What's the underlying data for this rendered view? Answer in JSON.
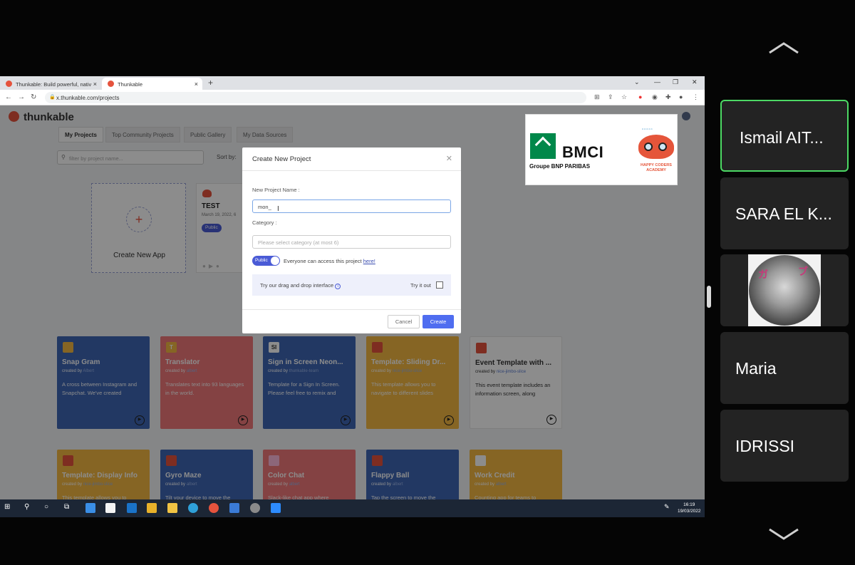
{
  "browser": {
    "tabs": [
      {
        "title": "Thunkable: Build powerful, nativ"
      },
      {
        "title": "Thunkable"
      }
    ],
    "url": "x.thunkable.com/projects"
  },
  "app": {
    "brand": "thunkable",
    "nav_tabs": [
      "My Projects",
      "Top Community Projects",
      "Public Gallery",
      "My Data Sources"
    ],
    "filter_placeholder": "filter by project name...",
    "sort_label": "Sort by:",
    "create_new_app": "Create New App",
    "project": {
      "name": "TEST",
      "date": "March 19, 2022, 6",
      "badge": "Public"
    }
  },
  "templates": [
    {
      "icon": "",
      "title": "Snap Gram",
      "by": "created by",
      "author": "Albert",
      "desc": "A cross between Instagram and Snapchat. We've created",
      "color": "#3e66b4"
    },
    {
      "icon": "T",
      "title": "Translator",
      "by": "created by",
      "author": "albert",
      "desc": "Translates text into 93 languages in the world.",
      "color": "#f0787a"
    },
    {
      "icon": "SI",
      "title": "Sign in Screen Neon...",
      "by": "created by",
      "author": "thunkable-team",
      "desc": "Template for a Sign In Screen. Please feel free to remix and",
      "color": "#3e66b4"
    },
    {
      "icon": "",
      "title": "Template: Sliding Dr...",
      "by": "created by",
      "author": "nice-jimbo-slice",
      "desc": "This template allows you to navigate to different slides",
      "color": "#f4b942"
    },
    {
      "icon": "",
      "title": "Event Template with ...",
      "by": "created by",
      "author": "nice-jimbo-slice",
      "desc": "This event template includes an information screen, along",
      "color": "#ffffff"
    },
    {
      "icon": "",
      "title": "Template: Display Info",
      "by": "created by",
      "author": "nice-jimbo-slice",
      "desc": "This template allows you to",
      "color": "#f4b942"
    },
    {
      "icon": "",
      "title": "Gyro Maze",
      "by": "created by",
      "author": "albert",
      "desc": "Tilt your device to move the",
      "color": "#3e66b4"
    },
    {
      "icon": "",
      "title": "Color Chat",
      "by": "created by",
      "author": "albert",
      "desc": "Slack-like chat app where",
      "color": "#f0787a"
    },
    {
      "icon": "",
      "title": "Flappy Ball",
      "by": "created by",
      "author": "albert",
      "desc": "Tap the screen to move the",
      "color": "#3e66b4"
    },
    {
      "icon": "",
      "title": "Work Credit",
      "by": "created by",
      "author": "albert",
      "desc": "Counting app for teams to",
      "color": "#f4b942"
    }
  ],
  "modal": {
    "title": "Create New Project",
    "name_label": "New Project Name :",
    "name_value": "mon_",
    "category_label": "Category :",
    "category_placeholder": "Please select category (at most 6)",
    "toggle_label": "Public",
    "public_text": "Everyone can access this project",
    "public_link": "here!",
    "dnd_text": "Try our drag and drop interface",
    "try_label": "Try it out",
    "cancel": "Cancel",
    "create": "Create"
  },
  "sponsor": {
    "bmci": "BMCI",
    "bmci_sub": "Groupe BNP PARIBAS",
    "academy": "HAPPY CODERS ACADEMY"
  },
  "taskbar": {
    "time": "16:19",
    "date": "19/03/2022"
  },
  "participants": [
    "Ismail AIT...",
    "SARA EL K...",
    "Maria",
    "IDRISSI"
  ]
}
